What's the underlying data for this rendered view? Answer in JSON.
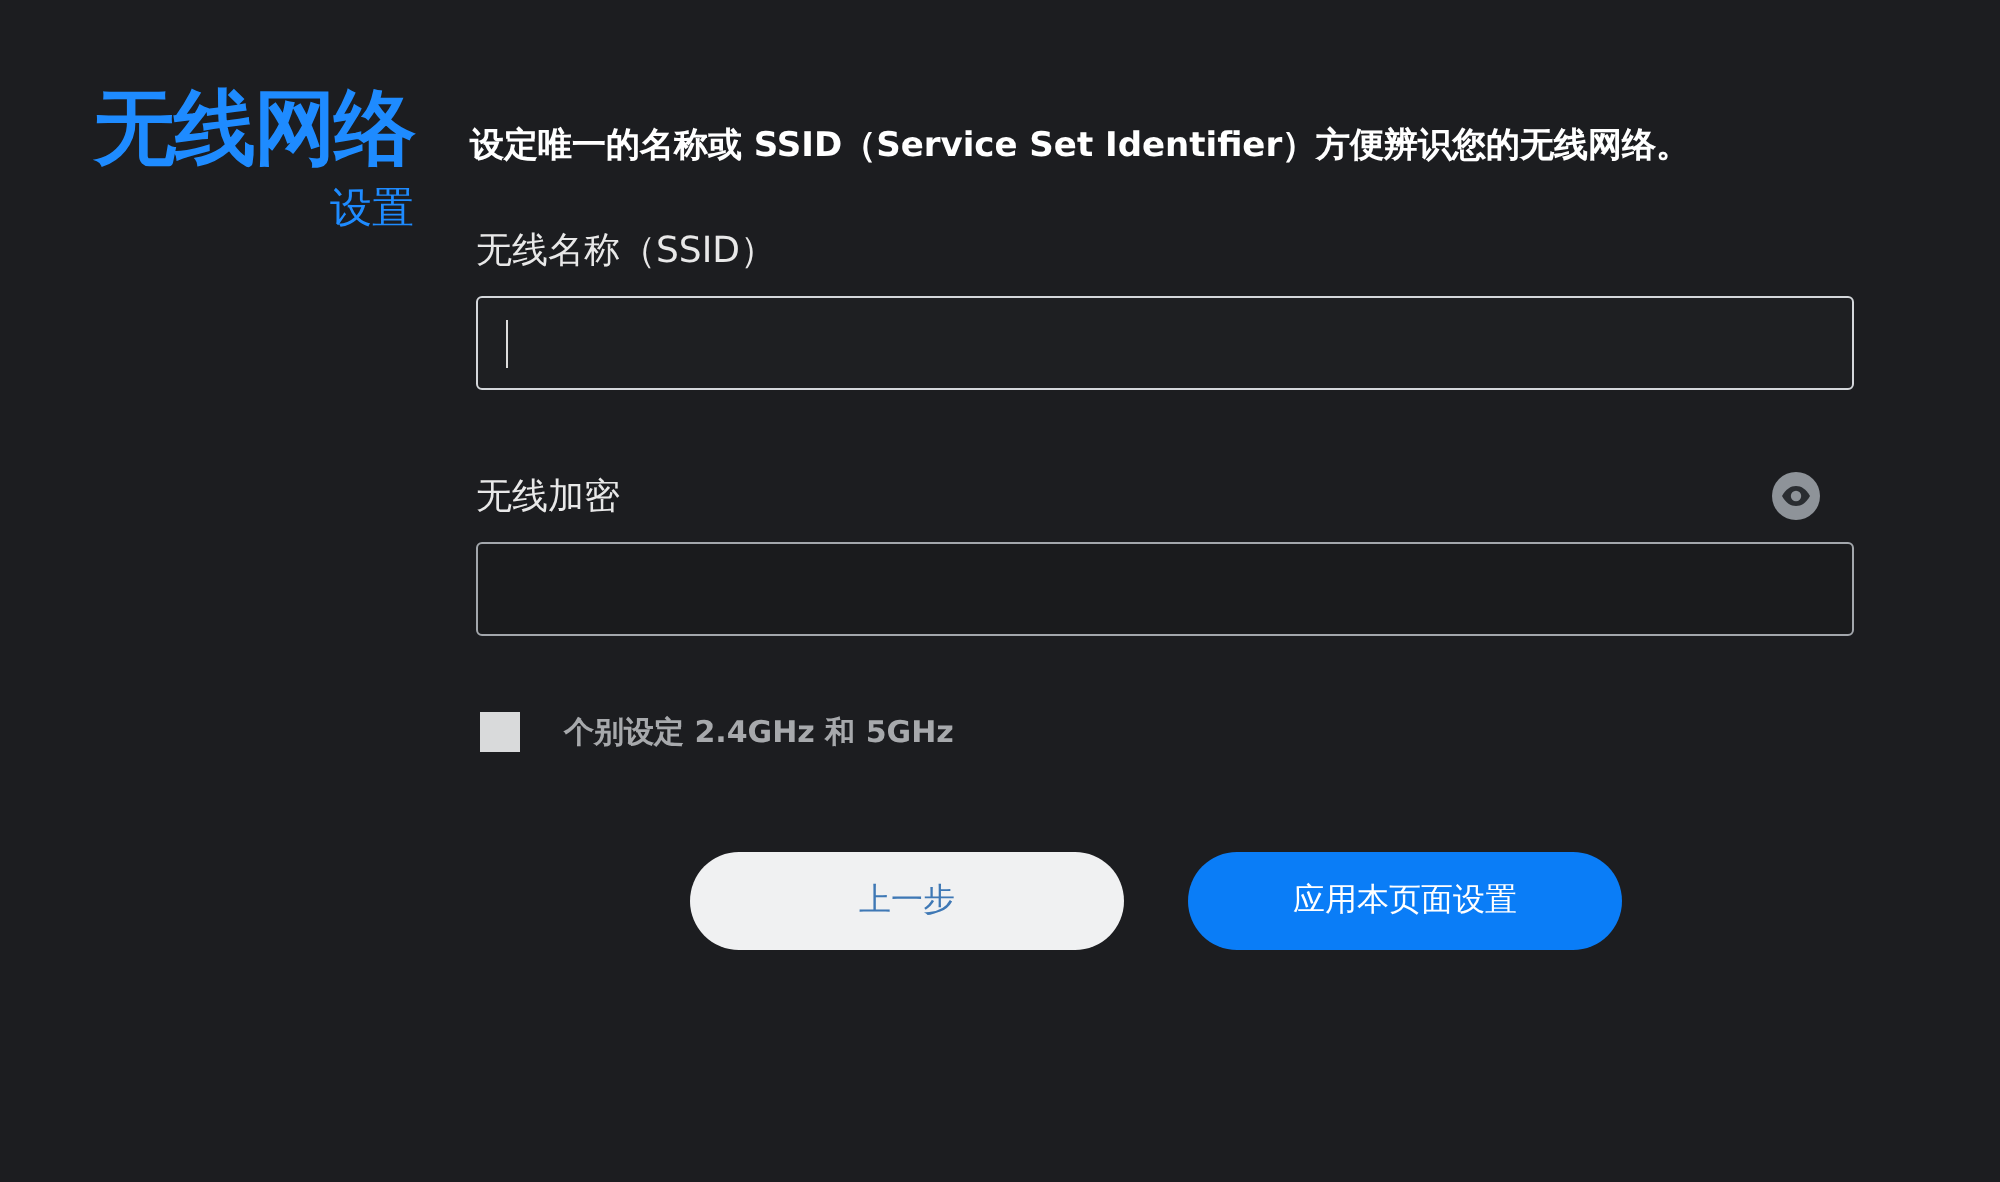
{
  "heading": {
    "title": "无线网络",
    "subtitle": "设置"
  },
  "description": "设定唯一的名称或 SSID（Service Set Identifier）方便辨识您的无线网络。",
  "fields": [
    {
      "label": "无线名称（SSID）",
      "focused": true,
      "show_toggle": false
    },
    {
      "label": "无线加密",
      "focused": false,
      "show_toggle": true
    }
  ],
  "option": {
    "label": "个别设定 2.4GHz 和 5GHz",
    "checked": false
  },
  "buttons": [
    {
      "label": "上一步",
      "kind": "secondary"
    },
    {
      "label": "应用本页面设置",
      "kind": "primary"
    }
  ]
}
